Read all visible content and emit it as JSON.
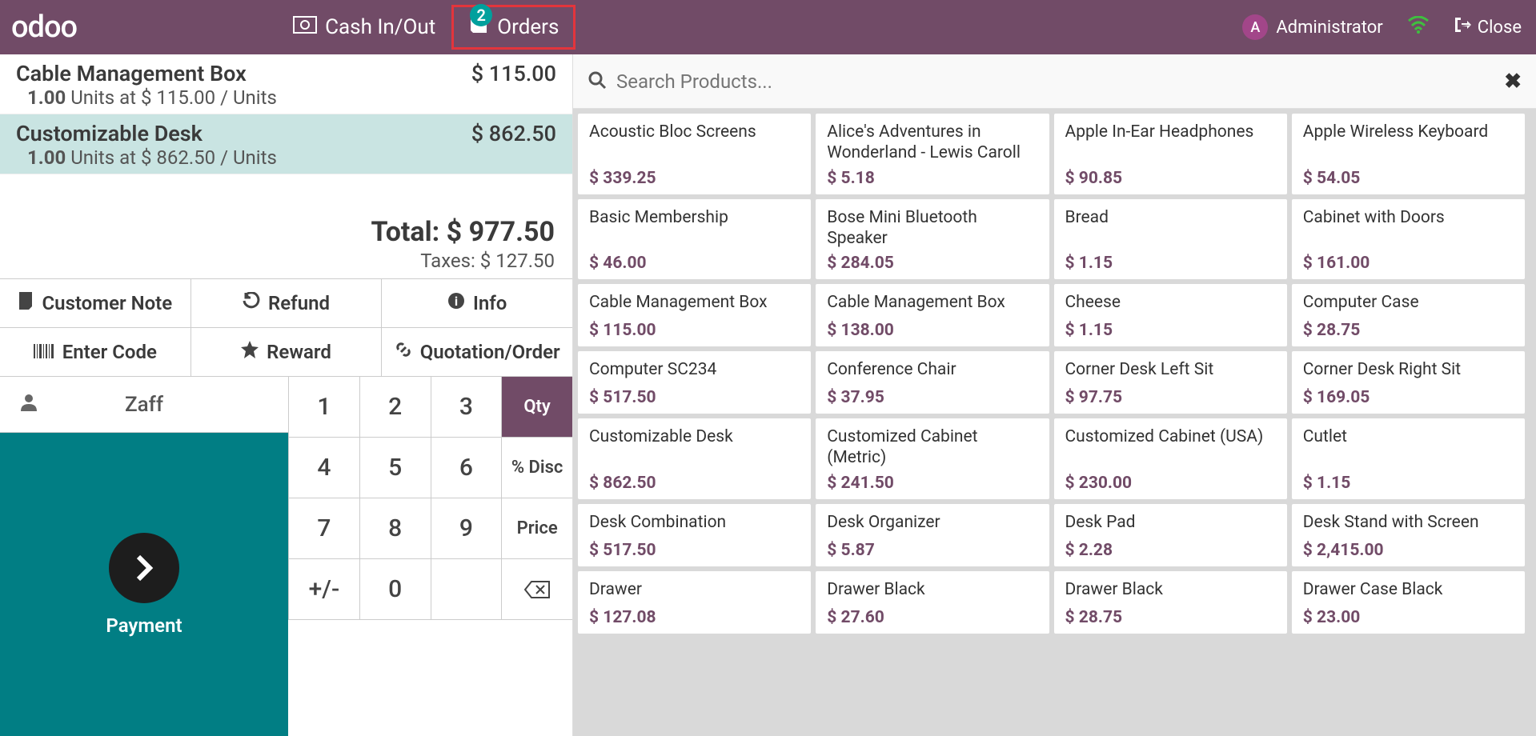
{
  "header": {
    "logo": "odoo",
    "cash_label": "Cash In/Out",
    "orders_label": "Orders",
    "orders_badge": "2",
    "admin_initial": "A",
    "admin_name": "Administrator",
    "close_label": "Close"
  },
  "order": {
    "lines": [
      {
        "name": "Cable Management Box",
        "price": "$ 115.00",
        "qty": "1.00",
        "detail": "Units at $ 115.00 / Units",
        "selected": false
      },
      {
        "name": "Customizable Desk",
        "price": "$ 862.50",
        "qty": "1.00",
        "detail": "Units at $ 862.50 / Units",
        "selected": true
      }
    ],
    "total_label": "Total: $ 977.50",
    "taxes_label": "Taxes: $ 127.50"
  },
  "actions": {
    "note": "Customer Note",
    "refund": "Refund",
    "info": "Info",
    "code": "Enter Code",
    "reward": "Reward",
    "quotation": "Quotation/Order"
  },
  "customer": {
    "name": "Zaff"
  },
  "payment": {
    "label": "Payment"
  },
  "numpad": {
    "keys": [
      "1",
      "2",
      "3",
      "4",
      "5",
      "6",
      "7",
      "8",
      "9",
      "+/-",
      "0"
    ],
    "qty": "Qty",
    "disc": "% Disc",
    "price": "Price",
    "backspace": "⌫"
  },
  "search": {
    "placeholder": "Search Products..."
  },
  "products": [
    {
      "name": "Acoustic Bloc Screens",
      "price": "$ 339.25",
      "tall": true
    },
    {
      "name": "Alice's Adventures in Wonderland - Lewis Caroll",
      "price": "$ 5.18",
      "tall": true
    },
    {
      "name": "Apple In-Ear Headphones",
      "price": "$ 90.85",
      "tall": true
    },
    {
      "name": "Apple Wireless Keyboard",
      "price": "$ 54.05",
      "tall": true
    },
    {
      "name": "Basic Membership",
      "price": "$ 46.00"
    },
    {
      "name": "Bose Mini Bluetooth Speaker",
      "price": "$ 284.05"
    },
    {
      "name": "Bread",
      "price": "$ 1.15"
    },
    {
      "name": "Cabinet with Doors",
      "price": "$ 161.00"
    },
    {
      "name": "Cable Management Box",
      "price": "$ 115.00"
    },
    {
      "name": "Cable Management Box",
      "price": "$ 138.00"
    },
    {
      "name": "Cheese",
      "price": "$ 1.15"
    },
    {
      "name": "Computer Case",
      "price": "$ 28.75"
    },
    {
      "name": "Computer SC234",
      "price": "$ 517.50"
    },
    {
      "name": "Conference Chair",
      "price": "$ 37.95"
    },
    {
      "name": "Corner Desk Left Sit",
      "price": "$ 97.75"
    },
    {
      "name": "Corner Desk Right Sit",
      "price": "$ 169.05"
    },
    {
      "name": "Customizable Desk",
      "price": "$ 862.50"
    },
    {
      "name": "Customized Cabinet (Metric)",
      "price": "$ 241.50"
    },
    {
      "name": "Customized Cabinet (USA)",
      "price": "$ 230.00"
    },
    {
      "name": "Cutlet",
      "price": "$ 1.15"
    },
    {
      "name": "Desk Combination",
      "price": "$ 517.50"
    },
    {
      "name": "Desk Organizer",
      "price": "$ 5.87"
    },
    {
      "name": "Desk Pad",
      "price": "$ 2.28"
    },
    {
      "name": "Desk Stand with Screen",
      "price": "$ 2,415.00"
    },
    {
      "name": "Drawer",
      "price": "$ 127.08"
    },
    {
      "name": "Drawer Black",
      "price": "$ 27.60"
    },
    {
      "name": "Drawer Black",
      "price": "$ 28.75"
    },
    {
      "name": "Drawer Case Black",
      "price": "$ 23.00"
    }
  ]
}
